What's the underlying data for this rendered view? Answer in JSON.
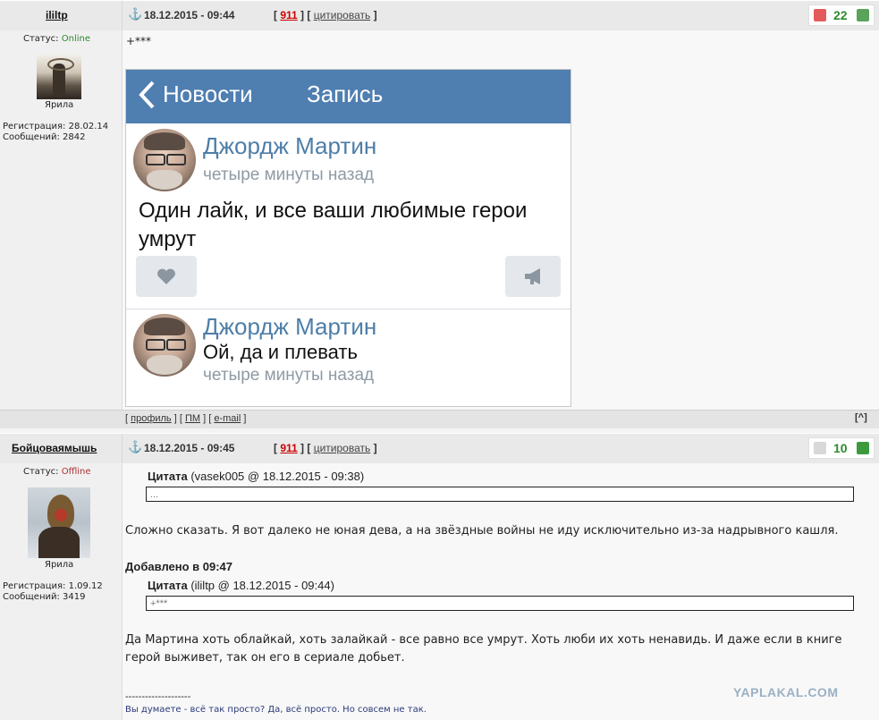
{
  "post1": {
    "username": "ililtp",
    "datetime": "18.12.2015 - 09:44",
    "badge": "911",
    "quote_link": "цитировать",
    "rating": "22",
    "status_label": "Статус:",
    "status_value": "Online",
    "rank": "Ярила",
    "registered": "Регистрация: 28.02.14",
    "messages": "Сообщений: 2842",
    "body_prefix": "+***",
    "screenshot": {
      "back": "Новости",
      "title": "Запись",
      "post": {
        "author": "Джордж Мартин",
        "time": "четыре минуты назад",
        "text": "Один лайк, и все ваши любимые герои умрут"
      },
      "comment": {
        "author": "Джордж Мартин",
        "text": "Ой, да и плевать",
        "time": "четыре минуты назад"
      }
    },
    "footer": {
      "profile": "профиль",
      "pm": "ПМ",
      "email": "e-mail",
      "top": "^"
    }
  },
  "post2": {
    "username": "Бойцоваямышь",
    "datetime": "18.12.2015 - 09:45",
    "badge": "911",
    "quote_link": "цитировать",
    "rating": "10",
    "status_label": "Статус:",
    "status_value": "Offline",
    "rank": "Ярила",
    "registered": "Регистрация: 1.09.12",
    "messages": "Сообщений: 3419",
    "quote1_label": "Цитата",
    "quote1_meta": "(vasek005 @ 18.12.2015 - 09:38)",
    "quote1_body": "...",
    "text1": "Сложно сказать. Я вот далеко не юная дева, а на звёздные войны не иду исключительно из-за надрывного кашля.",
    "added": "Добавлено в 09:47",
    "quote2_label": "Цитата",
    "quote2_meta": "(ililtp @ 18.12.2015 - 09:44)",
    "quote2_body": "+***",
    "text2_line1": "Да Мартина хоть облайкай, хоть залайкай - все равно все умрут. Хоть люби их хоть ненавидь. И даже если в книге",
    "text2_line2": "герой выживет, так он его в сериале добьет.",
    "sig_line": "--------------------",
    "signature": "Вы думаете - всё так просто? Да, всё просто. Но совсем не так."
  },
  "watermark": "YAPLAKAL.COM"
}
